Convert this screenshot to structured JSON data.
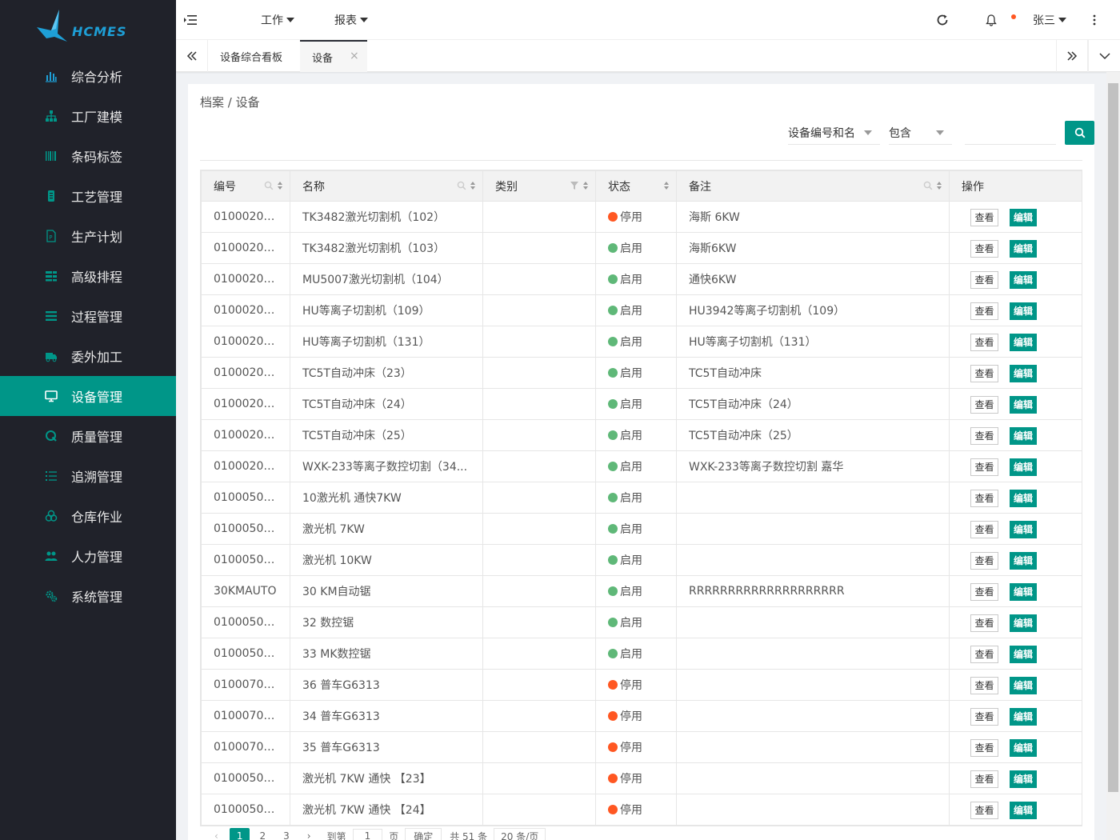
{
  "app": {
    "logo_text": "HCMES"
  },
  "sidebar": {
    "items": [
      {
        "label": "综合分析",
        "icon": "bar-chart-icon",
        "active": false
      },
      {
        "label": "工厂建模",
        "icon": "org-tree-icon",
        "active": false
      },
      {
        "label": "条码标签",
        "icon": "barcode-icon",
        "active": false
      },
      {
        "label": "工艺管理",
        "icon": "process-icon",
        "active": false
      },
      {
        "label": "生产计划",
        "icon": "plan-doc-icon",
        "active": false
      },
      {
        "label": "高级排程",
        "icon": "schedule-icon",
        "active": false
      },
      {
        "label": "过程管理",
        "icon": "list-icon",
        "active": false
      },
      {
        "label": "委外加工",
        "icon": "truck-icon",
        "active": false
      },
      {
        "label": "设备管理",
        "icon": "monitor-icon",
        "active": true
      },
      {
        "label": "质量管理",
        "icon": "quality-icon",
        "active": false
      },
      {
        "label": "追溯管理",
        "icon": "trace-list-icon",
        "active": false
      },
      {
        "label": "仓库作业",
        "icon": "warehouse-icon",
        "active": false
      },
      {
        "label": "人力管理",
        "icon": "users-icon",
        "active": false
      },
      {
        "label": "系统管理",
        "icon": "gears-icon",
        "active": false
      }
    ]
  },
  "header": {
    "nav": [
      {
        "label": "工作"
      },
      {
        "label": "报表"
      }
    ],
    "user": "张三"
  },
  "tabs": [
    {
      "label": "设备综合看板",
      "active": false
    },
    {
      "label": "设备",
      "active": true,
      "close": "×"
    }
  ],
  "breadcrumb": {
    "text": "档案 / 设备"
  },
  "filter": {
    "field": "设备编号和名",
    "op": "包含",
    "value": ""
  },
  "table": {
    "columns": [
      "编号",
      "名称",
      "类别",
      "状态",
      "备注",
      "操作"
    ],
    "view_label": "查看",
    "edit_label": "编辑",
    "rows": [
      {
        "code": "01000200...",
        "name": "TK3482激光切割机（102）",
        "category": "",
        "status": "停用",
        "remark": "海斯 6KW"
      },
      {
        "code": "01000200...",
        "name": "TK3482激光切割机（103）",
        "category": "",
        "status": "启用",
        "remark": "海斯6KW"
      },
      {
        "code": "01000200...",
        "name": "MU5007激光切割机（104）",
        "category": "",
        "status": "启用",
        "remark": "通快6KW"
      },
      {
        "code": "01000200...",
        "name": "HU等离子切割机（109）",
        "category": "",
        "status": "启用",
        "remark": "HU3942等离子切割机（109）"
      },
      {
        "code": "01000200...",
        "name": "HU等离子切割机（131）",
        "category": "",
        "status": "启用",
        "remark": "HU等离子切割机（131）"
      },
      {
        "code": "01000200...",
        "name": "TC5T自动冲床（23）",
        "category": "",
        "status": "启用",
        "remark": "TC5T自动冲床"
      },
      {
        "code": "01000200...",
        "name": "TC5T自动冲床（24）",
        "category": "",
        "status": "启用",
        "remark": "TC5T自动冲床（24）"
      },
      {
        "code": "01000200...",
        "name": "TC5T自动冲床（25）",
        "category": "",
        "status": "启用",
        "remark": "TC5T自动冲床（25）"
      },
      {
        "code": "01000200...",
        "name": "WXK-233等离子数控切割（34...",
        "category": "",
        "status": "启用",
        "remark": "WXK-233等离子数控切割 嘉华"
      },
      {
        "code": "01000500...",
        "name": "10激光机 通快7KW",
        "category": "",
        "status": "启用",
        "remark": ""
      },
      {
        "code": "01000500...",
        "name": "激光机 7KW",
        "category": "",
        "status": "启用",
        "remark": ""
      },
      {
        "code": "01000500...",
        "name": "激光机 10KW",
        "category": "",
        "status": "启用",
        "remark": ""
      },
      {
        "code": "30KMAUTO",
        "name": "30 KM自动锯",
        "category": "",
        "status": "启用",
        "remark": "RRRRRRRRRRRRRRRRRRRR"
      },
      {
        "code": "01000500...",
        "name": "32 数控锯",
        "category": "",
        "status": "启用",
        "remark": ""
      },
      {
        "code": "01000500...",
        "name": "33 MK数控锯",
        "category": "",
        "status": "启用",
        "remark": ""
      },
      {
        "code": "01000700...",
        "name": "36 普车G6313",
        "category": "",
        "status": "停用",
        "remark": ""
      },
      {
        "code": "01000700...",
        "name": "34 普车G6313",
        "category": "",
        "status": "停用",
        "remark": ""
      },
      {
        "code": "01000700...",
        "name": "35 普车G6313",
        "category": "",
        "status": "停用",
        "remark": ""
      },
      {
        "code": "01000500...",
        "name": "激光机 7KW 通快 【23】",
        "category": "",
        "status": "停用",
        "remark": ""
      },
      {
        "code": "01000500...",
        "name": "激光机 7KW 通快 【24】",
        "category": "",
        "status": "停用",
        "remark": ""
      }
    ]
  },
  "pager": {
    "pages": [
      "1",
      "2",
      "3"
    ],
    "goto_prefix": "到第",
    "goto_value": "1",
    "goto_suffix": "页",
    "confirm": "确定",
    "total": "共 51 条",
    "page_size": "20 条/页"
  },
  "colors": {
    "accent": "#009688",
    "sidebar_bg": "#20222a",
    "status_on": "#5fb878",
    "status_off": "#ff5722"
  }
}
